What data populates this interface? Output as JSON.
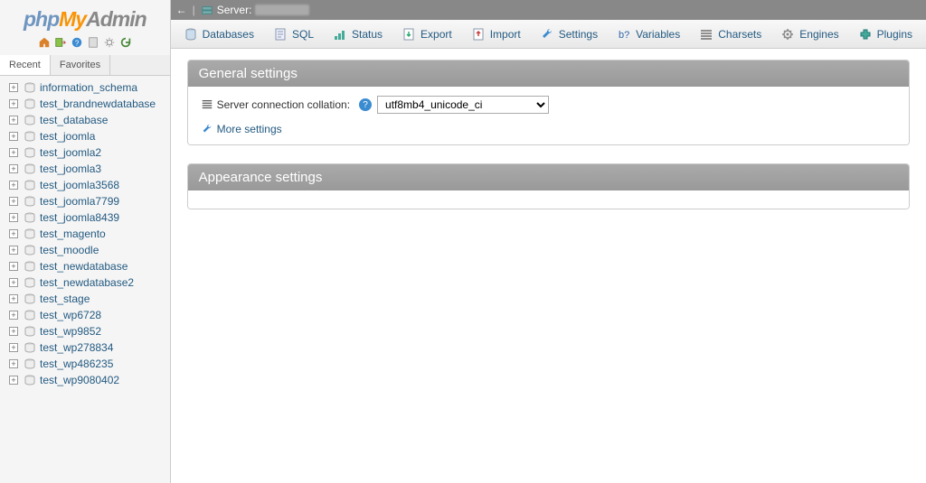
{
  "logo": {
    "part1": "php",
    "part2": "My",
    "part3": "Admin"
  },
  "sidebar_tabs": {
    "recent": "Recent",
    "favorites": "Favorites"
  },
  "breadcrumb": {
    "server_label": "Server:"
  },
  "tabs": [
    {
      "id": "databases",
      "label": "Databases"
    },
    {
      "id": "sql",
      "label": "SQL"
    },
    {
      "id": "status",
      "label": "Status"
    },
    {
      "id": "export",
      "label": "Export"
    },
    {
      "id": "import",
      "label": "Import"
    },
    {
      "id": "settings",
      "label": "Settings"
    },
    {
      "id": "variables",
      "label": "Variables"
    },
    {
      "id": "charsets",
      "label": "Charsets"
    },
    {
      "id": "engines",
      "label": "Engines"
    },
    {
      "id": "plugins",
      "label": "Plugins"
    }
  ],
  "databases": [
    "information_schema",
    "test_brandnewdatabase",
    "test_database",
    "test_joomla",
    "test_joomla2",
    "test_joomla3",
    "test_joomla3568",
    "test_joomla7799",
    "test_joomla8439",
    "test_magento",
    "test_moodle",
    "test_newdatabase",
    "test_newdatabase2",
    "test_stage",
    "test_wp6728",
    "test_wp9852",
    "test_wp278834",
    "test_wp486235",
    "test_wp9080402"
  ],
  "panels": {
    "general": {
      "title": "General settings",
      "collation_label": "Server connection collation:",
      "collation_value": "utf8mb4_unicode_ci",
      "more_settings": "More settings"
    },
    "appearance": {
      "title": "Appearance settings"
    }
  }
}
